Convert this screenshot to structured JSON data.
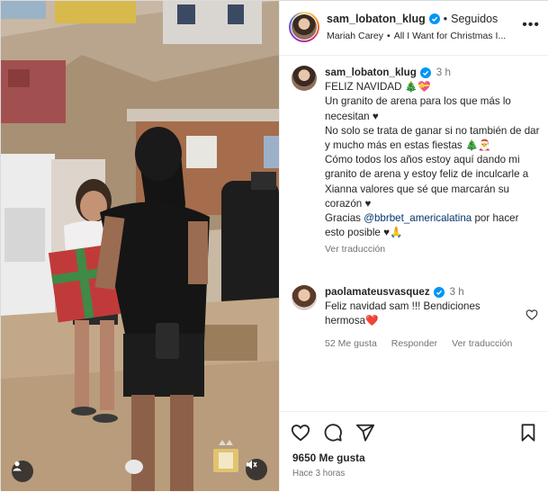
{
  "post": {
    "author": "sam_lobaton_klug",
    "header": {
      "follow_status": "Seguidos",
      "song_artist": "Mariah Carey",
      "song_title": "All I Want for Christmas I..."
    },
    "caption": {
      "time": "3 h",
      "line1": "FELIZ NAVIDAD 🎄💝",
      "line2": "Un granito de arena para los que más lo necesitan ♥",
      "line3": "No solo se trata de ganar si no también de dar y mucho más en estas fiestas 🎄🎅",
      "line4": "Cómo todos los años estoy aquí dando mi granito de arena y estoy feliz de inculcarle a Xianna valores que sé que marcarán su corazón ♥",
      "line5_prefix": "Gracias",
      "line5_mention": "@bbrbet_americalatina",
      "line5_suffix": "por hacer esto posible ♥🙏",
      "translate": "Ver traducción"
    },
    "comment": {
      "author": "paolamateusvasquez",
      "time": "3 h",
      "text": "Feliz navidad sam !!! Bendiciones hermosa❤️",
      "likes": "52 Me gusta",
      "reply": "Responder",
      "translate": "Ver traducción"
    },
    "footer": {
      "likes": "9650 Me gusta",
      "time_ago": "Hace 3 horas"
    },
    "icons": {
      "like": "heart-icon",
      "comment": "comment-icon",
      "share": "share-icon",
      "save": "bookmark-icon",
      "user": "user-tag-icon",
      "mute": "muted-speaker-icon",
      "verified": "verified-badge-icon"
    },
    "colors": {
      "verified": "#0095f6",
      "link": "#00376b",
      "secondary_text": "#737373"
    }
  }
}
